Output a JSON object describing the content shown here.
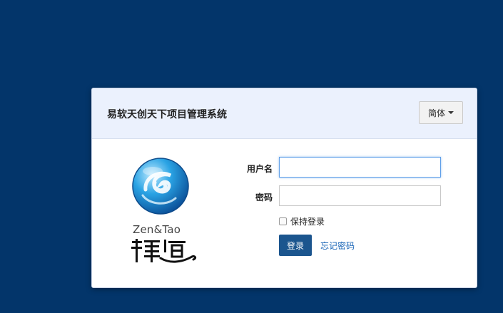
{
  "header": {
    "title": "易软天创天下项目管理系统",
    "language_button": "简体"
  },
  "brand": {
    "latin_name": "Zen&Tao",
    "mark": "禪道"
  },
  "form": {
    "username_label": "用户名",
    "username_value": "",
    "password_label": "密码",
    "password_value": "",
    "remember_label": "保持登录",
    "remember_checked": false,
    "login_button": "登录",
    "forgot_link": "忘记密码"
  },
  "colors": {
    "background": "#03356a",
    "header_bg": "#ebf1fd",
    "primary_button": "#1b558e",
    "link": "#1663b6"
  }
}
